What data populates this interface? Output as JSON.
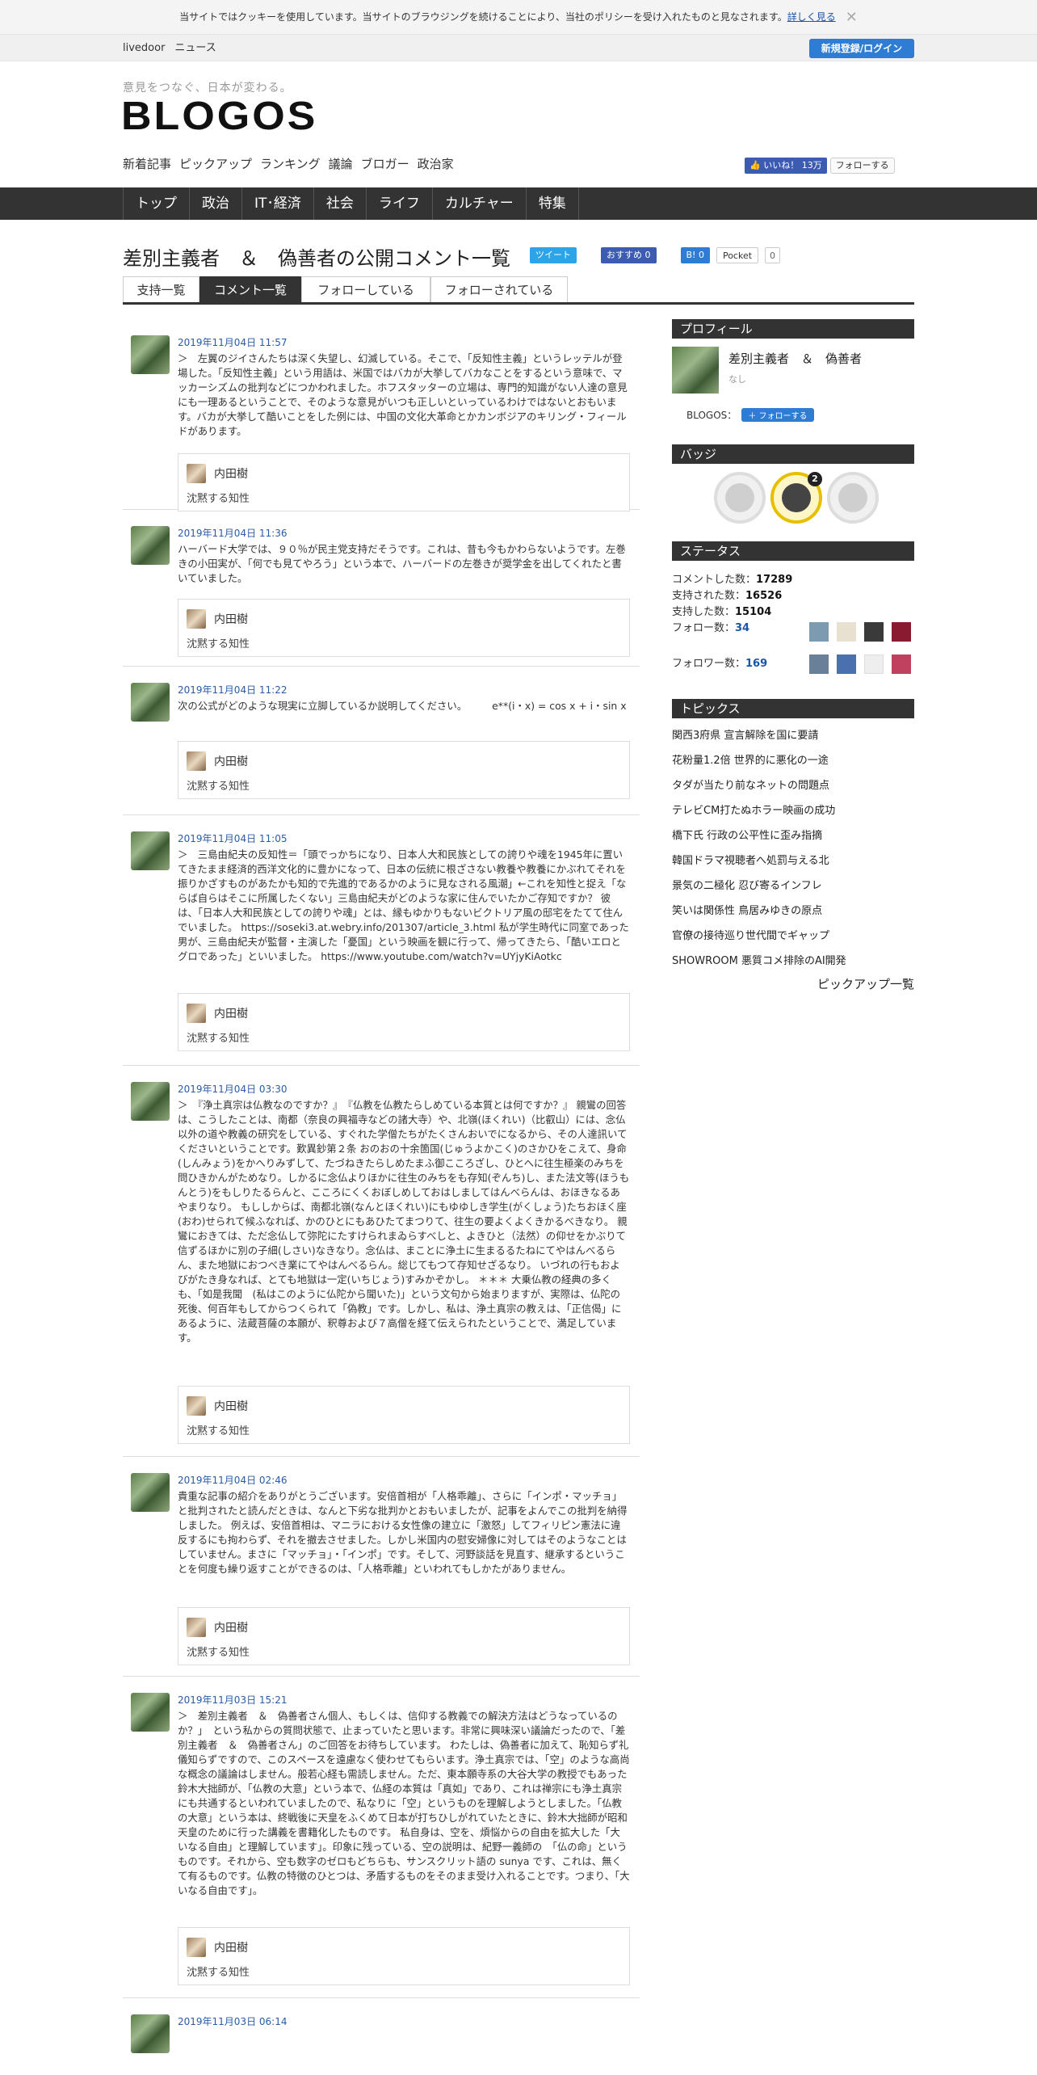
{
  "cookie": {
    "text": "当サイトではクッキーを使用しています。当サイトのブラウジングを続けることにより、当社のポリシーを受け入れたものと見なされます。",
    "link": "詳しく見る",
    "close": "✕"
  },
  "topbar": {
    "links": [
      "livedoor",
      "ニュース"
    ],
    "login": "新規登録/ログイン"
  },
  "header": {
    "tagline": "意見をつなぐ、日本が変わる。",
    "logo": "BLOGOS",
    "subnav": [
      "新着記事",
      "ピックアップ",
      "ランキング",
      "議論",
      "ブロガー",
      "政治家"
    ],
    "like": "👍 いいね！ 13万",
    "follow": "フォローする"
  },
  "gnav": [
    "トップ",
    "政治",
    "IT･経済",
    "社会",
    "ライフ",
    "カルチャー",
    "特集"
  ],
  "page": {
    "title": "差別主義者　＆　偽善者の公開コメント一覧",
    "tweet": "ツイート",
    "fb": "おすすめ 0",
    "hatena": "B! 0",
    "pocket": "Pocket",
    "pocket_count": "0"
  },
  "tabs": [
    "支持一覧",
    "コメント一覧",
    "フォローしている",
    "フォローされている"
  ],
  "comments": [
    {
      "date": "2019年11月04日 11:57",
      "text": "＞　左翼のジイさんたちは深く失望し、幻滅している。そこで、「反知性主義」というレッテルが登場した。「反知性主義」という用語は、米国ではバカが大挙してバカなことをするという意味で、マッカーシズムの批判などにつかわれました。ホフスタッターの立場は、専門的知識がない人達の意見にも一理あるということで、そのような意見がいつも正しいといっているわけではないとおもいます。バカが大挙して酷いことをした例には、中国の文化大革命とかカンボジアのキリング・フィールドがあります。",
      "author": "内田樹",
      "author_sub": "沈黙する知性"
    },
    {
      "date": "2019年11月04日 11:36",
      "text": "ハーバード大学では、９０％が民主党支持だそうです。これは、昔も今もかわらないようです。左巻きの小田実が、「何でも見てやろう」という本で、ハーバードの左巻きが奨学金を出してくれたと書いていました。",
      "author": "内田樹",
      "author_sub": "沈黙する知性"
    },
    {
      "date": "2019年11月04日 11:22",
      "text": "次の公式がどのような現実に立脚しているか説明してください。　　　e**(i・x) = cos x + i・sin x",
      "author": "内田樹",
      "author_sub": "沈黙する知性"
    },
    {
      "date": "2019年11月04日 11:05",
      "text": "＞　三島由紀夫の反知性＝「頭でっかちになり、日本人大和民族としての誇りや魂を1945年に置いてきたまま経済的西洋文化的に豊かになって、日本の伝統に根ざさない教養や教養にかぶれてそれを振りかざすものがあたかも知的で先進的であるかのように見なされる風潮」←これを知性と捉え「ならば自らはそこに所属したくない」三島由紀夫がどのような家に住んでいたかご存知ですか？ 彼は、「日本人大和民族としての誇りや魂」とは、縁もゆかりもないビクトリア風の邸宅をたてて住んでいました。 https://soseki3.at.webry.info/201307/article_3.html 私が学生時代に同室であった男が、三島由紀夫が監督・主演した「憂国」という映画を観に行って、帰ってきたら、「酷いエロとグロであった」といいました。 https://www.youtube.com/watch?v=UYjyKiAotkc",
      "author": "内田樹",
      "author_sub": "沈黙する知性"
    },
    {
      "date": "2019年11月04日 03:30",
      "text": "＞　『浄土真宗は仏教なのですか？』　『仏教を仏教たらしめている本質とは何ですか？』 親鸞の回答は、こうしたことは、南都（奈良の興福寺などの諸大寺）や、北嶺(ほくれい)（比叡山）には、念仏以外の道や教義の研究をしている、すぐれた学僧たちがたくさんおいでになるから、その人達訊いてくださいということです。歎異鈔第２条 おのおの十余箇国(じゅうよかこく)のさかひをこえて、身命(しんみょう)をかへりみずして、たづねきたらしめたまふ御こころざし、ひとへに往生極楽のみちを問ひきかんがためなり。しかるに念仏よりほかに往生のみちをも存知(ぞんち)し、また法文等(ほうもんとう)をもしりたるらんと、こころにくくおぼしめしておはしましてはんべらんは、おほきなるあやまりなり。 もししからば、南都北嶺(なんとほくれい)にもゆゆしき学生(がくしょう)たちおほく座(おわ)せられて候ふなれば、かのひとにもあひたてまつりて、往生の要よくよくきかるべきなり。 親鸞におきては、ただ念仏して弥陀にたすけられまゐらすべしと、よきひと（法然）の仰せをかぶりて信ずるほかに別の子細(しさい)なきなり。念仏は、まことに浄土に生まるるたねにてやはんべるらん、また地獄におつべき業にてやはんべるらん。総じてもつて存知せざるなり。 いづれの行もおよびがたき身なれば、とても地獄は一定(いちじょう)すみかぞかし。 ＊＊＊ 大乗仏教の経典の多くも、「如是我聞　(私はこのように仏陀から聞いた)」という文句から始まりますが、実際は、仏陀の死後、何百年もしてからつくられて「偽教」です。しかし、私は、浄土真宗の教えは、「正信偈」にあるように、法蔵菩薩の本願が、釈尊および７高僧を経て伝えられたということで、満足しています。",
      "author": "内田樹",
      "author_sub": "沈黙する知性"
    },
    {
      "date": "2019年11月04日 02:46",
      "text": "貴重な記事の紹介をありがとうございます。安倍首相が「人格乖離」、さらに「インポ・マッチョ」と批判されたと読んだときは、なんと下劣な批判かとおもいましたが、記事をよんでこの批判を納得しました。 例えば、安倍首相は、マニラにおける女性像の建立に「激怒」してフィリピン憲法に違反するにも拘わらず、それを撤去させました。しかし米国内の慰安婦像に対してはそのようなことはしていません。まさに「マッチョ」・「インポ」です。そして、河野談話を見直す、継承するということを何度も繰り返すことができるのは、「人格乖離」といわれてもしかたがありません。",
      "author": "内田樹",
      "author_sub": "沈黙する知性"
    },
    {
      "date": "2019年11月03日 15:21",
      "text": "＞　差別主義者　＆　偽善者さん個人、もしくは、信仰する教義での解決方法はどうなっているのか？」　という私からの質問状態で、止まっていたと思います。非常に興味深い議論だったので、「差別主義者　＆　偽善者さん」のご回答をお待ちしています。 わたしは、偽善者に加えて、恥知らず礼儀知らずですので、このスペースを遠慮なく使わせてもらいます。浄土真宗では、「空」のような高尚な概念の議論はしません。般若心経も需読しません。ただ、東本願寺系の大谷大学の教授でもあった鈴木大拙師が、「仏教の大意」という本で、仏経の本質は「真如」であり、これは禅宗にも浄土真宗にも共通するといわれていましたので、私なりに「空」というものを理解しようとしました。「仏教の大意」という本は、終戦後に天皇をふくめて日本が打ちひしがれていたときに、鈴木大拙師が昭和天皇のために行った講義を書籍化したものです。 私自身は、空を、煩悩からの自由を拡大した「大いなる自由」と理解しています」。印象に残っている、空の説明は、紀野一義師の　「仏の命」というものです。それから、空も数字のゼロもどちらも、サンスクリット語の sunya です、これは、無くて有るものです。仏教の特徴のひとつは、矛盾するものをそのまま受け入れることです。つまり、「大いなる自由です」。",
      "author": "内田樹",
      "author_sub": "沈黙する知性"
    },
    {
      "date": "2019年11月03日 06:14",
      "text": "",
      "author": "",
      "author_sub": ""
    }
  ],
  "sidebar": {
    "profile": {
      "heading": "プロフィール",
      "name": "差別主義者　＆　偽善者",
      "desc": "なし",
      "blogos": "BLOGOS：",
      "follow": "＋ フォローする"
    },
    "badge": {
      "heading": "バッジ",
      "count": "2"
    },
    "status": {
      "heading": "ステータス",
      "rows": [
        {
          "label": "コメントした数：",
          "value": "17289"
        },
        {
          "label": "支持された数：",
          "value": "16526"
        },
        {
          "label": "支持した数：",
          "value": "15104"
        },
        {
          "label": "フォロー数：",
          "value": "34"
        },
        {
          "label": "フォロワー数：",
          "value": "169"
        }
      ]
    },
    "topics": {
      "heading": "トピックス",
      "items": [
        "関西3府県 宣言解除を国に要請",
        "花粉量1.2倍 世界的に悪化の一途",
        "タダが当たり前なネットの問題点",
        "テレビCM打たぬホラー映画の成功",
        "橋下氏 行政の公平性に歪み指摘",
        "韓国ドラマ視聴者へ処罰与える北",
        "景気の二極化 忍び寄るインフレ",
        "笑いは関係性 鳥居みゆきの原点",
        "官僚の接待巡り世代間でギャップ",
        "SHOWROOM 悪質コメ排除のAI開発"
      ],
      "more": "ピックアップ一覧"
    }
  }
}
